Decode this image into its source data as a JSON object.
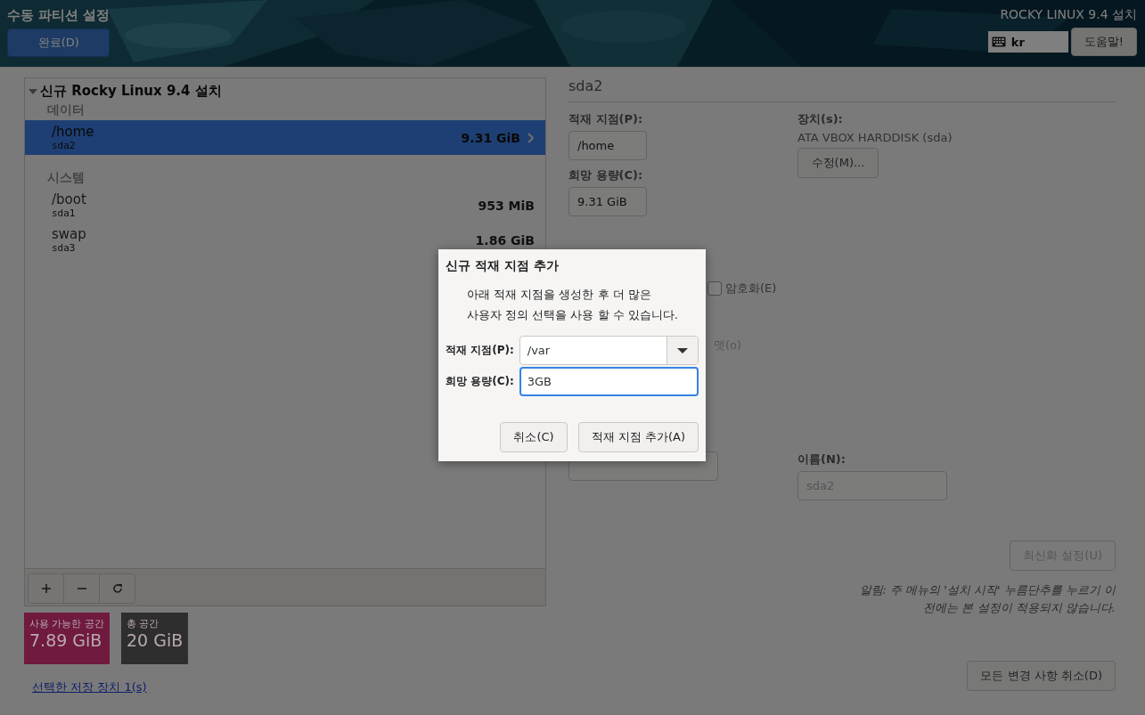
{
  "header": {
    "title": "수동 파티션 설정",
    "done_button": "완료(D)",
    "product": "ROCKY LINUX 9.4 설치",
    "keyboard": "kr",
    "help_button": "도움말!"
  },
  "tree": {
    "title": "신규 Rocky Linux 9.4 설치",
    "expanded": true,
    "groups": [
      {
        "label": "데이터",
        "items": [
          {
            "name": "/home",
            "device": "sda2",
            "size": "9.31 GiB",
            "selected": true
          }
        ]
      },
      {
        "label": "시스템",
        "items": [
          {
            "name": "/boot",
            "device": "sda1",
            "size": "953 MiB",
            "selected": false
          },
          {
            "name": "swap",
            "device": "sda3",
            "size": "1.86 GiB",
            "selected": false
          }
        ]
      }
    ]
  },
  "space": [
    {
      "label": "사용 가능한 공간",
      "value": "7.89 GiB",
      "color": "#6f1a3e"
    },
    {
      "label": "총 공간",
      "value": "20 GiB",
      "color": "#2e2e2e"
    }
  ],
  "storage_link": "선택한 저장 장치 1(s)",
  "detail": {
    "title": "sda2",
    "mount_label": "적재 지점(P):",
    "mount_value": "/home",
    "capacity_label": "희망 용량(C):",
    "capacity_value": "9.31 GiB",
    "devices_label": "장치(s):",
    "device_name": "ATA VBOX HARDDISK (sda)",
    "modify_button": "수정(M)...",
    "encrypt": {
      "label": "암호화(E)",
      "checked": false
    },
    "format_fragment": "맷(o)",
    "name_label": "이름(N):",
    "name_value": "sda2",
    "update_button": "최신화 설정(U)",
    "update_disabled": true,
    "note": "알림: 주 메뉴의 '설치 시작' 누름단추를 누르기 이전에는 본 설정이 적용되지 않습니다."
  },
  "reset_button": "모든 변경 사항 취소(D)",
  "dialog": {
    "title": "신규 적재 지점 추가",
    "message_lines": [
      "아래 적재 지점을 생성한 후 더 많은",
      "사용자 정의 선택을 사용 할 수 있습니다."
    ],
    "mount_label": "적재 지점(P):",
    "mount_value": "/var",
    "capacity_label": "희망 용량(C):",
    "capacity_value": "3GB",
    "buttons": [
      "취소(C)",
      "적재 지점 추가(A)"
    ]
  }
}
